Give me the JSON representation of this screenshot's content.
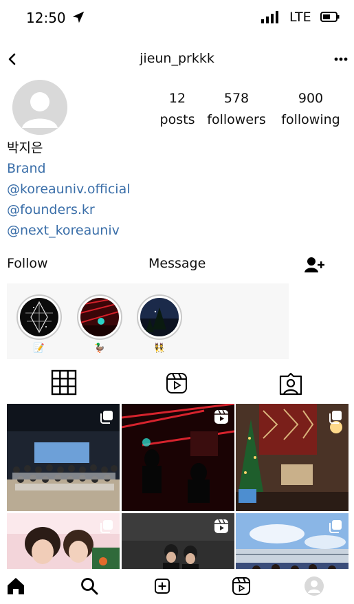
{
  "status_bar": {
    "time": "12:50",
    "network": "LTE"
  },
  "header": {
    "username": "jieun_prkkk"
  },
  "profile": {
    "stats": [
      {
        "count": "12",
        "label": "posts"
      },
      {
        "count": "578",
        "label": "followers"
      },
      {
        "count": "900",
        "label": "following"
      }
    ],
    "display_name": "박지은",
    "category": "Brand",
    "links": [
      "@koreauniv.official",
      "@founders.kr",
      "@next_koreauniv"
    ]
  },
  "actions": {
    "follow_label": "Follow",
    "message_label": "Message"
  },
  "highlights": [
    {
      "caption": "📝"
    },
    {
      "caption": "🦆"
    },
    {
      "caption": "👯"
    }
  ],
  "tabs": [
    "grid-tab",
    "reels-tab",
    "tagged-tab"
  ],
  "colors": {
    "link": "#3b6fa9",
    "text": "#111111",
    "avatar_placeholder": "#d9d9d9"
  }
}
